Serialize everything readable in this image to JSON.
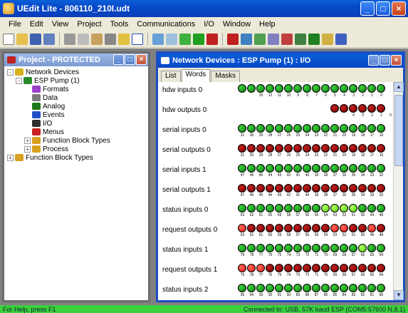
{
  "window": {
    "title": "UEdit Lite - 806110_210I.udt"
  },
  "menu": [
    "File",
    "Edit",
    "View",
    "Project",
    "Tools",
    "Communications",
    "I/O",
    "Window",
    "Help"
  ],
  "project_window": {
    "title": "Project - PROTECTED",
    "tree": [
      {
        "label": "Network Devices",
        "level": 0,
        "expander": "-",
        "icon": "folder-network-icon",
        "color": "#d8b020"
      },
      {
        "label": "ESP Pump (1)",
        "level": 1,
        "expander": "-",
        "icon": "device-icon",
        "color": "#2a8a2a"
      },
      {
        "label": "Formats",
        "level": 2,
        "expander": "",
        "icon": "formats-icon",
        "color": "#9a40c8"
      },
      {
        "label": "Data",
        "level": 2,
        "expander": "",
        "icon": "data-icon",
        "color": "#7b7b7b"
      },
      {
        "label": "Analog",
        "level": 2,
        "expander": "",
        "icon": "analog-icon",
        "color": "#1a7a1a"
      },
      {
        "label": "Events",
        "level": 2,
        "expander": "",
        "icon": "events-icon",
        "color": "#2050c8"
      },
      {
        "label": "I/O",
        "level": 2,
        "expander": "",
        "icon": "io-icon",
        "color": "#303030"
      },
      {
        "label": "Menus",
        "level": 2,
        "expander": "",
        "icon": "menus-icon",
        "color": "#c82020"
      },
      {
        "label": "Function Block Types",
        "level": 2,
        "expander": "+",
        "icon": "function-block-icon",
        "color": "#d8a020"
      },
      {
        "label": "Process",
        "level": 2,
        "expander": "+",
        "icon": "process-icon",
        "color": "#d8a020"
      },
      {
        "label": "Function Block Types",
        "level": 0,
        "expander": "+",
        "icon": "function-block-icon",
        "color": "#d8a020"
      }
    ]
  },
  "net_window": {
    "title": "Network Devices : ESP Pump (1) : I/O",
    "tabs": [
      "List",
      "Words",
      "Masks"
    ],
    "active_tab": 1,
    "rows": [
      {
        "label": "hdw inputs 0",
        "offset": 10,
        "leds": "gggggggggggggggg",
        "nums": [
          "15",
          "12",
          "11",
          "10",
          "9",
          "8",
          "7",
          "6",
          "5",
          "4",
          "3",
          "2",
          "1",
          "0"
        ]
      },
      {
        "label": "hdw outputs 0",
        "offset": 10,
        "leds": "..........rrrrrr",
        "nums": [
          "",
          "",
          "",
          "",
          "",
          "",
          "",
          "",
          "",
          "",
          "4",
          "3",
          "2",
          "1",
          "0"
        ]
      },
      {
        "label": "serial inputs 0",
        "offset": 0,
        "leds": "gggggggggggggggg",
        "nums": [
          "31",
          "30",
          "29",
          "28",
          "27",
          "26",
          "25",
          "24",
          "23",
          "22",
          "21",
          "20",
          "19",
          "18",
          "17",
          "16"
        ]
      },
      {
        "label": "serial outputs 0",
        "offset": 0,
        "leds": "rrrrrrrrrrrrrrrr",
        "nums": [
          "31",
          "30",
          "29",
          "28",
          "27",
          "26",
          "25",
          "24",
          "23",
          "22",
          "21",
          "20",
          "19",
          "18",
          "17",
          "16"
        ]
      },
      {
        "label": "serial inputs 1",
        "offset": 0,
        "leds": "gggggggggggggggg",
        "nums": [
          "47",
          "46",
          "45",
          "44",
          "43",
          "42",
          "41",
          "40",
          "39",
          "38",
          "37",
          "36",
          "35",
          "34",
          "33",
          "32"
        ]
      },
      {
        "label": "serial outputs 1",
        "offset": 0,
        "leds": "rrrrrrrrrrrrrrrr",
        "nums": [
          "47",
          "46",
          "45",
          "44",
          "43",
          "42",
          "41",
          "40",
          "39",
          "38",
          "37",
          "36",
          "35",
          "34",
          "33",
          "32"
        ]
      },
      {
        "label": "status inputs 0",
        "offset": 0,
        "leds": "gggggggggllllggg",
        "nums": [
          "63",
          "62",
          "61",
          "60",
          "59",
          "58",
          "57",
          "56",
          "55",
          "54",
          "53",
          "52",
          "51",
          "50",
          "49",
          "48"
        ]
      },
      {
        "label": "request outputs 0",
        "offset": 0,
        "leds": "brrrrrrrrrbbrrbr",
        "nums": [
          "63",
          "62",
          "61",
          "60",
          "59",
          "58",
          "57",
          "56",
          "55",
          "54",
          "53",
          "52",
          "51",
          "50",
          "49",
          "48"
        ]
      },
      {
        "label": "status inputs 1",
        "offset": 0,
        "leds": "ggggggggggggglgg",
        "nums": [
          "79",
          "78",
          "77",
          "76",
          "75",
          "74",
          "73",
          "72",
          "71",
          "70",
          "69",
          "68",
          "67",
          "66",
          "65",
          "64"
        ]
      },
      {
        "label": "request outputs 1",
        "offset": 0,
        "leds": "bbbrrrrrrrrrrrrr",
        "nums": [
          "79",
          "78",
          "77",
          "76",
          "75",
          "74",
          "73",
          "72",
          "71",
          "70",
          "69",
          "68",
          "67",
          "66",
          "65",
          "64"
        ]
      },
      {
        "label": "status inputs 2",
        "offset": 0,
        "leds": "gggggggggggggggg",
        "nums": [
          "95",
          "94",
          "93",
          "92",
          "91",
          "90",
          "89",
          "88",
          "87",
          "86",
          "85",
          "84",
          "83",
          "82",
          "81",
          "80"
        ]
      }
    ]
  },
  "status_bar": {
    "left": "For Help, press F1",
    "right": "Connected to: USB, 57K baud ESP (COM5:57600 N,8,1)"
  }
}
